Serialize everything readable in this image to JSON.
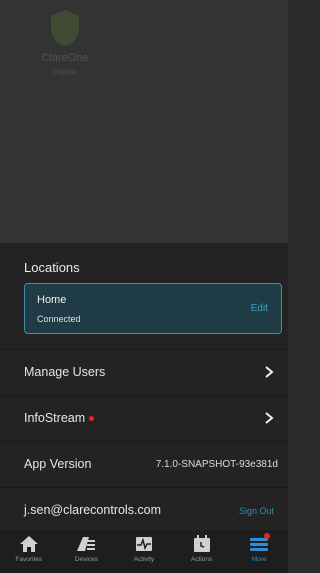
{
  "brand": {
    "name": "ClareOne",
    "sub": "Home"
  },
  "locations": {
    "title": "Locations",
    "items": [
      {
        "name": "Home",
        "status": "Connected",
        "edit_label": "Edit"
      }
    ]
  },
  "menu": {
    "manage_users": "Manage Users",
    "infostream": "InfoStream",
    "app_version_label": "App Version",
    "app_version_value": "7.1.0-SNAPSHOT-93e381d",
    "account_email": "j.sen@clarecontrols.com",
    "sign_out": "Sign Out"
  },
  "tabs": [
    {
      "label": "Favorites",
      "icon": "home-icon"
    },
    {
      "label": "Devices",
      "icon": "devices-icon"
    },
    {
      "label": "Activity",
      "icon": "activity-icon"
    },
    {
      "label": "Actions",
      "icon": "calendar-icon"
    },
    {
      "label": "More",
      "icon": "menu-icon"
    }
  ],
  "colors": {
    "accent": "#2d8fd6",
    "card_border": "#3f8fa5",
    "badge": "#e52626"
  }
}
